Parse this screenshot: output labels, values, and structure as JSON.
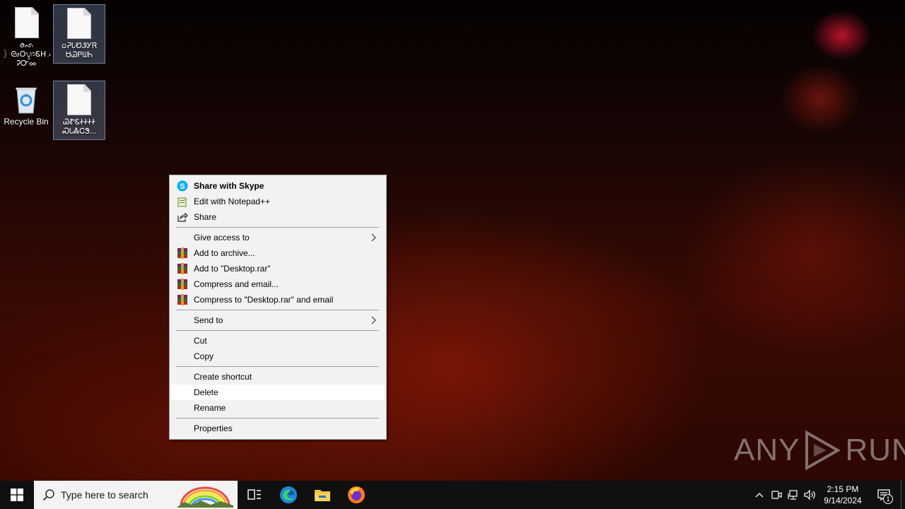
{
  "desktop": {
    "icons": [
      {
        "label": "ꪮᨒ\n〗ᘓ᥆ᱛᬌᏋᕼ᎕\nᎮᏅᨖ",
        "name": "file-icon-1"
      },
      {
        "label": "ᨵᕈᏓᏬᏭᎩᏒ\nᏌᏊᏢᗯᏂ",
        "name": "file-icon-2"
      },
      {
        "label": "Recycle Bin",
        "name": "recycle-bin"
      },
      {
        "label": "ᏊᏑᏋᏐᏐᏐᏐ\nᏍᏓᏜᏟᏕ...",
        "name": "file-icon-3"
      }
    ]
  },
  "context_menu": {
    "items": [
      {
        "label": "Share with Skype",
        "icon": "skype-icon"
      },
      {
        "label": "Edit with Notepad++",
        "icon": "notepad-plus-plus-icon"
      },
      {
        "label": "Share",
        "icon": "share-icon"
      },
      {
        "label": "Give access to",
        "icon": ""
      },
      {
        "label": "Add to archive...",
        "icon": "winrar-icon"
      },
      {
        "label": "Add to \"Desktop.rar\"",
        "icon": "winrar-icon"
      },
      {
        "label": "Compress and email...",
        "icon": "winrar-icon"
      },
      {
        "label": "Compress to \"Desktop.rar\" and email",
        "icon": "winrar-icon"
      },
      {
        "label": "Send to",
        "icon": ""
      },
      {
        "label": "Cut",
        "icon": ""
      },
      {
        "label": "Copy",
        "icon": ""
      },
      {
        "label": "Create shortcut",
        "icon": ""
      },
      {
        "label": "Delete",
        "icon": ""
      },
      {
        "label": "Rename",
        "icon": ""
      },
      {
        "label": "Properties",
        "icon": ""
      }
    ]
  },
  "watermark": {
    "left": "ANY",
    "right": "RUN"
  },
  "taskbar": {
    "search_placeholder": "Type here to search",
    "pinned": [
      "task-view-icon",
      "edge-icon",
      "file-explorer-icon",
      "firefox-icon"
    ],
    "time": "2:15 PM",
    "date": "9/14/2024",
    "notification_count": "1"
  },
  "colors": {
    "menu_bg": "#f2f2f2",
    "taskbar_bg": "#101010",
    "accent_skype": "#00aff0"
  }
}
